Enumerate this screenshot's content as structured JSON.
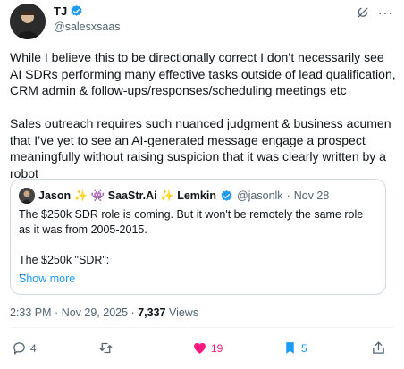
{
  "author": {
    "name": "TJ",
    "handle": "@salesxsaas"
  },
  "tweet": {
    "paragraph_1": "While I believe this to be directionally correct I don’t necessarily see AI SDRs performing many effective tasks outside of lead qualification, CRM admin & follow-ups/responses/scheduling meetings etc",
    "paragraph_2": "Sales outreach requires such nuanced judgment & business acumen that I’ve yet to see an AI-generated message engage a prospect meaningfully without raising suspicion that it was clearly written by a robot"
  },
  "quote": {
    "name_part_1": "Jason",
    "name_part_2": "SaaStr.Ai",
    "name_part_3": "Lemkin",
    "handle": "@jasonlk",
    "separator": "·",
    "date": "Nov 28",
    "line_1": "The $250k SDR role is coming. But it won't be remotely the same role as it was from 2005-2015.",
    "line_2": "The $250k \"SDR\":",
    "line_3": "...",
    "show_more": "Show more"
  },
  "meta": {
    "time": "2:33 PM",
    "separator": "·",
    "date": "Nov 29, 2025",
    "views_count": "7,337",
    "views_label": "Views"
  },
  "actions": {
    "replies": "4",
    "likes": "19",
    "bookmarks": "5"
  },
  "colors": {
    "accent": "#1d9bf0",
    "like": "#f91880",
    "text": "#0f1419",
    "muted": "#536471"
  }
}
